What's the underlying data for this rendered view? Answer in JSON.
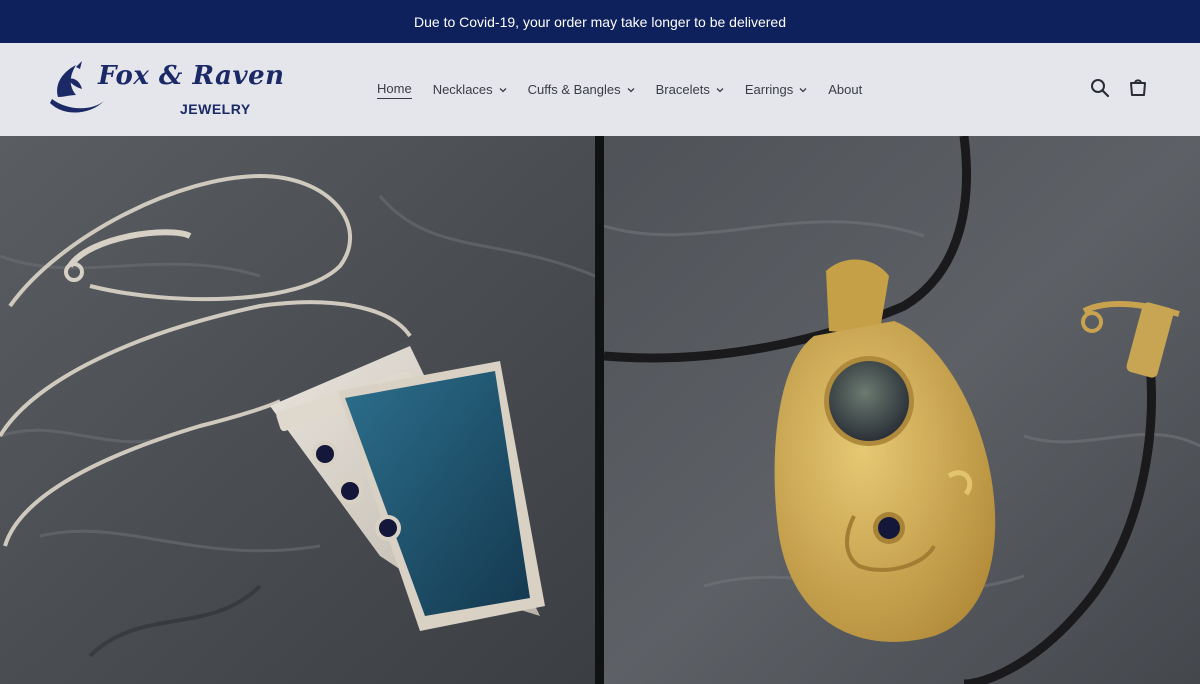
{
  "announcement": {
    "text": "Due to Covid-19, your order may take longer to be delivered"
  },
  "header": {
    "logo": {
      "name": "Fox & Raven",
      "sub": "JEWELRY"
    },
    "nav": [
      {
        "label": "Home",
        "active": true,
        "dropdown": false
      },
      {
        "label": "Necklaces",
        "dropdown": true
      },
      {
        "label": "Cuffs & Bangles",
        "dropdown": true
      },
      {
        "label": "Bracelets",
        "dropdown": true
      },
      {
        "label": "Earrings",
        "dropdown": true
      },
      {
        "label": "About",
        "dropdown": false
      }
    ],
    "icons": [
      "search-icon",
      "cart-icon"
    ]
  },
  "hero": {
    "left": "silver-pendant-necklace-photo",
    "right": "gold-pendant-necklace-photo"
  },
  "colors": {
    "announcement_bg": "#0f215c",
    "header_bg": "#e5e6ec",
    "brand": "#1b2a66"
  }
}
